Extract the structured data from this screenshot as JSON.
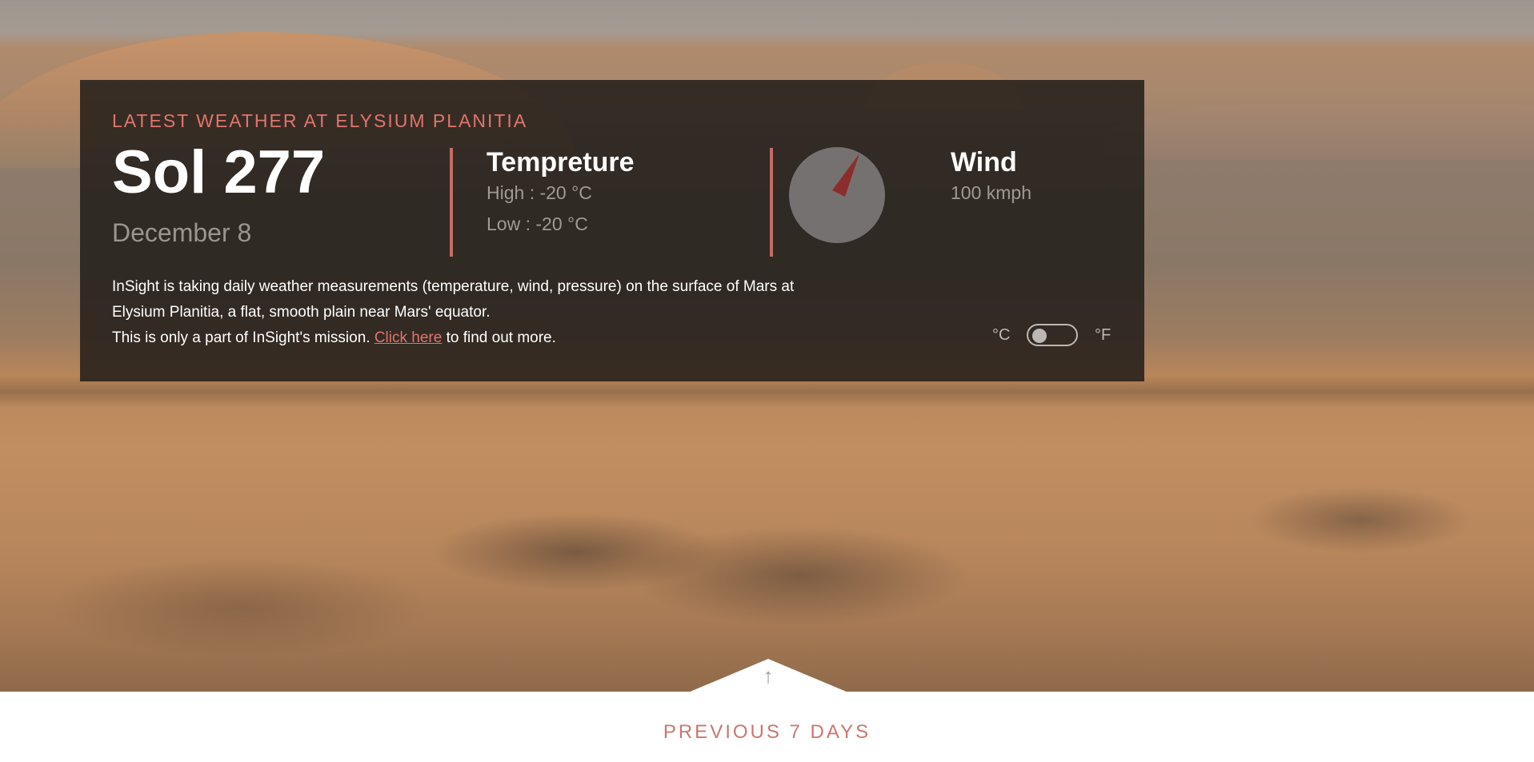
{
  "weather": {
    "label": "LATEST WEATHER AT ELYSIUM PLANITIA",
    "sol": "Sol 277",
    "date": "December 8",
    "temperature": {
      "title": "Tempreture",
      "high": "High : -20 °C",
      "low": "Low : -20 °C"
    },
    "wind": {
      "title": "Wind",
      "speed": "100 kmph",
      "compass_icon": "compass-icon",
      "needle_color": "#8b2e2b"
    },
    "info": {
      "line1": "InSight is taking daily weather measurements (temperature, wind, pressure) on the surface of Mars at Elysium Planitia, a flat, smooth plain near Mars' equator.",
      "line2_before": "This is only a part of InSight's mission. ",
      "link": "Click here",
      "line2_after": " to find out more."
    },
    "unit_toggle": {
      "celsius": "°C",
      "fahrenheit": "°F",
      "selected": "°C"
    }
  },
  "footer": {
    "arrow": "↑",
    "previous_days": "PREVIOUS 7 DAYS"
  },
  "colors": {
    "accent": "#e0756d",
    "divider": "#c66b67",
    "card_bg": "rgba(28, 24, 22, 0.82)"
  }
}
